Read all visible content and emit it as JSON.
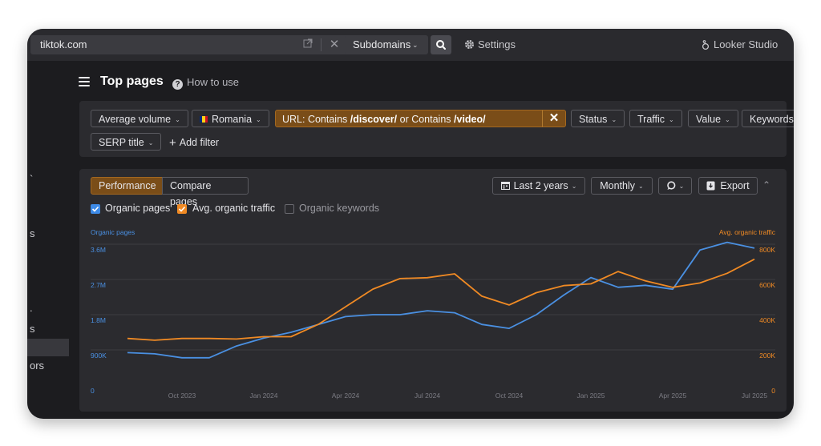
{
  "topbar": {
    "url": "tiktok.com",
    "subdomains_label": "Subdomains",
    "settings_label": "Settings",
    "looker_label": "Looker Studio"
  },
  "sidebar": {
    "fragments": [
      "`",
      "s",
      ".",
      "s",
      "ors"
    ]
  },
  "header": {
    "title": "Top pages",
    "how_to_use": "How to use"
  },
  "filters": {
    "volume": "Average volume",
    "country": "Romania",
    "url_prefix": "URL: Contains ",
    "url_value1": "/discover/",
    "url_mid": " or Contains ",
    "url_value2": "/video/",
    "status": "Status",
    "traffic": "Traffic",
    "value": "Value",
    "keywords": "Keywords",
    "serp_title": "SERP title",
    "add_filter": "Add filter"
  },
  "performance": {
    "tab_performance": "Performance",
    "tab_compare": "Compare pages",
    "range": "Last 2 years",
    "interval": "Monthly",
    "export": "Export",
    "checkboxes": {
      "organic_pages": "Organic pages",
      "avg_traffic": "Avg. organic traffic",
      "organic_keywords": "Organic keywords"
    }
  },
  "colors": {
    "pages_line": "#4a90e2",
    "traffic_line": "#f08a24",
    "accent_orange": "#7a4d18"
  },
  "chart_data": {
    "type": "line",
    "title": "",
    "y_left_title": "Organic pages",
    "y_right_title": "Avg. organic traffic",
    "y_left_ticks": [
      "0",
      "900K",
      "1.8M",
      "2.7M",
      "3.6M"
    ],
    "y_right_ticks": [
      "0",
      "200K",
      "400K",
      "600K",
      "800K"
    ],
    "y_left_range": [
      0,
      3600000
    ],
    "y_right_range": [
      0,
      800000
    ],
    "x_tick_labels": [
      "Oct 2023",
      "Jan 2024",
      "Apr 2024",
      "Jul 2024",
      "Oct 2024",
      "Jan 2025",
      "Apr 2025",
      "Jul 2025"
    ],
    "x": [
      "2023-08",
      "2023-09",
      "2023-10",
      "2023-11",
      "2023-12",
      "2024-01",
      "2024-02",
      "2024-03",
      "2024-04",
      "2024-05",
      "2024-06",
      "2024-07",
      "2024-08",
      "2024-09",
      "2024-10",
      "2024-11",
      "2024-12",
      "2025-01",
      "2025-02",
      "2025-03",
      "2025-04",
      "2025-05",
      "2025-06",
      "2025-07"
    ],
    "series": [
      {
        "name": "Organic pages",
        "axis": "left",
        "color": "#4a90e2",
        "values": [
          830000,
          800000,
          700000,
          700000,
          1000000,
          1200000,
          1350000,
          1550000,
          1750000,
          1800000,
          1800000,
          1900000,
          1850000,
          1550000,
          1450000,
          1800000,
          2300000,
          2750000,
          2500000,
          2550000,
          2450000,
          3450000,
          3650000,
          3500000
        ]
      },
      {
        "name": "Avg. organic traffic",
        "axis": "right",
        "color": "#f08a24",
        "values": [
          265000,
          255000,
          265000,
          265000,
          262000,
          275000,
          275000,
          345000,
          445000,
          545000,
          605000,
          610000,
          632000,
          505000,
          455000,
          525000,
          565000,
          575000,
          645000,
          592000,
          555000,
          580000,
          635000,
          715000
        ]
      }
    ],
    "grid": true,
    "legend": "checkboxes-top-left"
  }
}
